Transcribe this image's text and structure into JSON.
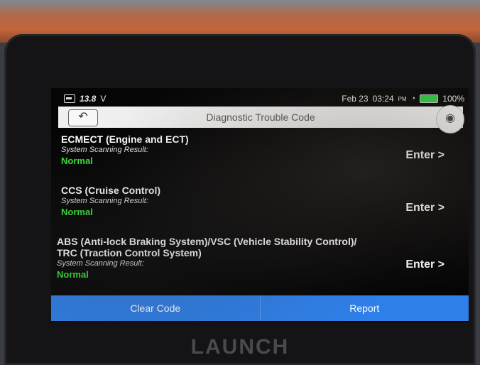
{
  "status_bar": {
    "voltage": "13.8",
    "voltage_unit": "V",
    "date": "Feb 23",
    "time": "03:24",
    "ampm": "PM",
    "battery": "100%",
    "battery_color": "#2ecc40"
  },
  "header": {
    "title": "Diagnostic Trouble Code",
    "back_icon": "back-arrow-icon",
    "camera_icon": "camera-icon"
  },
  "systems": [
    {
      "name": "ECMECT (Engine and ECT)",
      "label": "System Scanning Result:",
      "result": "Normal",
      "action": "Enter >"
    },
    {
      "name": "CCS (Cruise Control)",
      "label": "System Scanning Result:",
      "result": "Normal",
      "action": "Enter >"
    },
    {
      "name": "ABS (Anti-lock Braking System)/VSC (Vehicle Stability Control)/",
      "name_line2": "TRC (Traction Control System)",
      "label": "System Scanning Result:",
      "result": "Normal",
      "action": "Enter >"
    }
  ],
  "footer": {
    "clear_code": "Clear Code",
    "report": "Report",
    "accent_color": "#2f7fe8"
  },
  "device_brand": "LAUNCH",
  "colors": {
    "normal_status": "#36e636"
  }
}
